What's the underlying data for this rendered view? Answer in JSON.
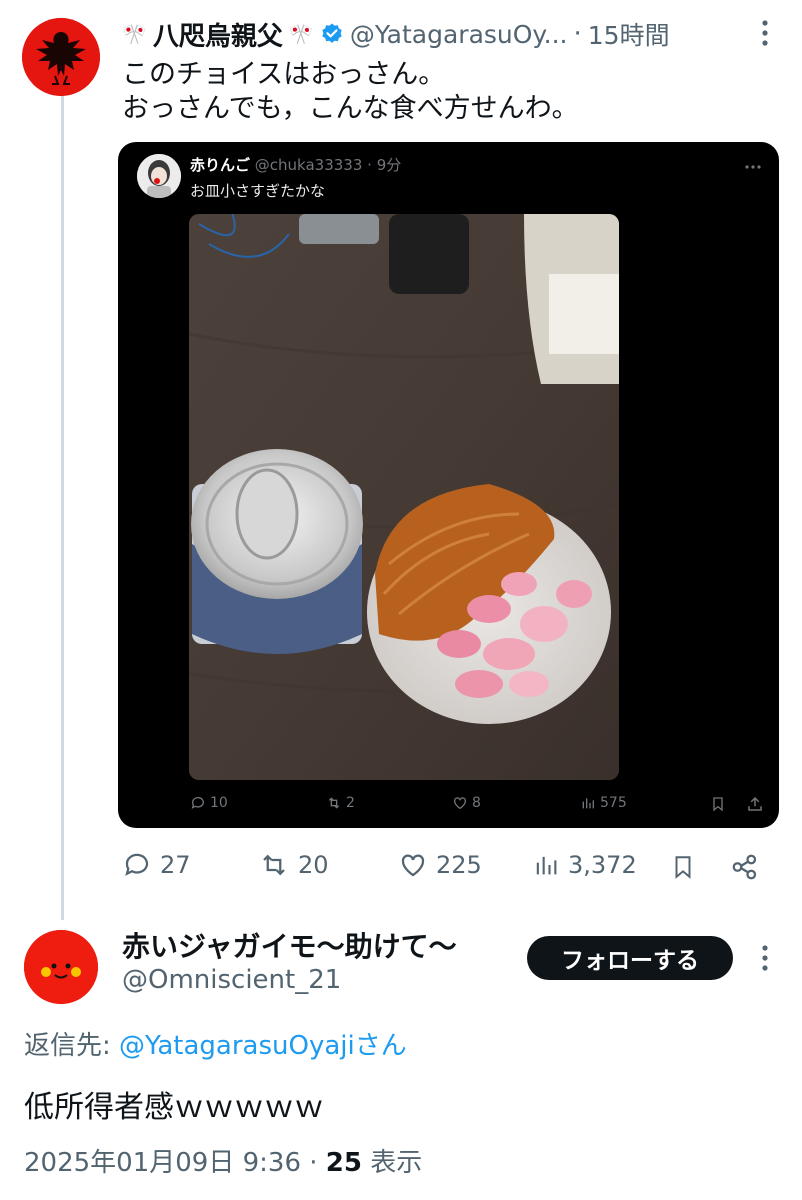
{
  "tweet": {
    "flag_left": "🎌",
    "display_name": "八咫烏親父",
    "flag_right": "🎌",
    "handle": "@YatagarasuOy...",
    "separator": "·",
    "time": "15時間",
    "line1": "このチョイスはおっさん。",
    "line2": "おっさんでも，こんな食べ方せんわ。",
    "stats": {
      "replies": "27",
      "retweets": "20",
      "likes": "225",
      "views": "3,372"
    },
    "icons": {
      "avatar": "crow-emblem-avatar",
      "verified": "verified-badge-icon"
    }
  },
  "quote": {
    "display_name": "赤りんご",
    "handle": "@chuka33333",
    "separator": "·",
    "time": "9分",
    "text": "お皿小さすぎたかな",
    "stats": {
      "replies": "10",
      "retweets": "2",
      "likes": "8",
      "views": "575"
    }
  },
  "reply": {
    "display_name": "赤いジャガイモ〜助けて〜",
    "handle": "@Omniscient_21",
    "follow_label": "フォローする",
    "reply_prefix": "返信先: ",
    "reply_target": "@YatagarasuOyaji",
    "reply_suffix": "さん",
    "text": "低所得者感ｗｗｗｗｗ",
    "timestamp": "2025年01月09日 9:36 · ",
    "views_count": "25",
    "views_label": " 表示"
  },
  "colors": {
    "accent": "#1d9bf0",
    "text_secondary": "#536471",
    "quote_bg": "#000000",
    "avatar_red": "#ee1d10"
  }
}
